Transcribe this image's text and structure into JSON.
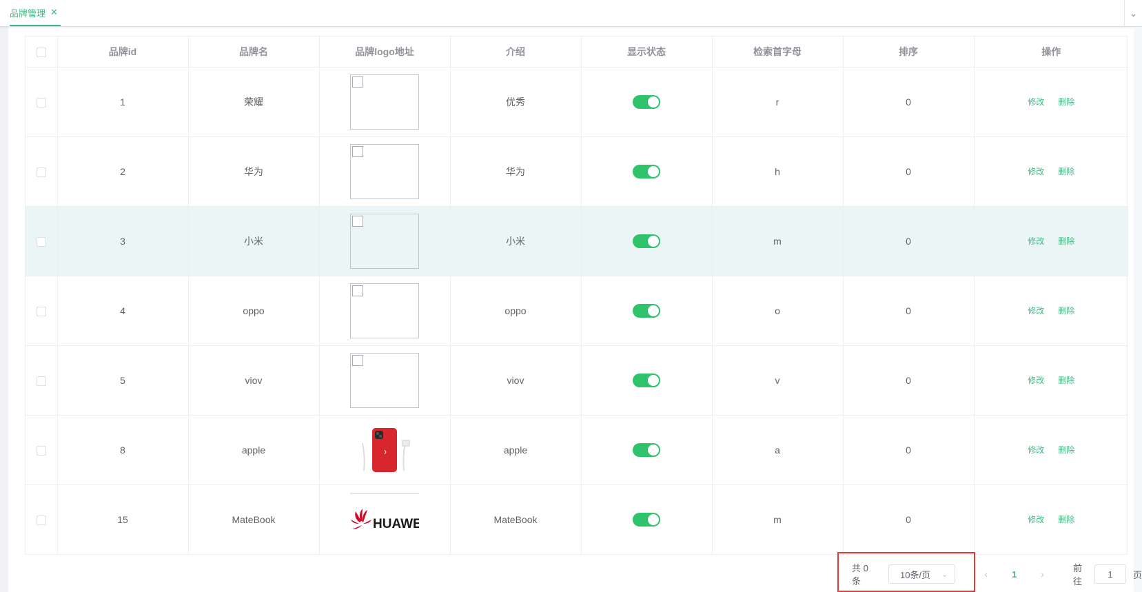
{
  "tabs": [
    {
      "label": "品牌管理",
      "active": true
    }
  ],
  "table": {
    "headers": [
      "品牌id",
      "品牌名",
      "品牌logo地址",
      "介绍",
      "显示状态",
      "检索首字母",
      "排序",
      "操作"
    ],
    "rows": [
      {
        "id": "1",
        "name": "荣耀",
        "logo": "broken",
        "desc": "优秀",
        "show": true,
        "letter": "r",
        "sort": "0"
      },
      {
        "id": "2",
        "name": "华为",
        "logo": "broken",
        "desc": "华为",
        "show": true,
        "letter": "h",
        "sort": "0"
      },
      {
        "id": "3",
        "name": "小米",
        "logo": "broken",
        "desc": "小米",
        "show": true,
        "letter": "m",
        "sort": "0"
      },
      {
        "id": "4",
        "name": "oppo",
        "logo": "broken",
        "desc": "oppo",
        "show": true,
        "letter": "o",
        "sort": "0"
      },
      {
        "id": "5",
        "name": "viov",
        "logo": "broken",
        "desc": "viov",
        "show": true,
        "letter": "v",
        "sort": "0"
      },
      {
        "id": "8",
        "name": "apple",
        "logo": "iphone-image",
        "desc": "apple",
        "show": true,
        "letter": "a",
        "sort": "0"
      },
      {
        "id": "15",
        "name": "MateBook",
        "logo": "huawei-logo",
        "desc": "MateBook",
        "show": true,
        "letter": "m",
        "sort": "0"
      }
    ],
    "edit_label": "修改",
    "delete_label": "删除"
  },
  "pagination": {
    "total": "共 0 条",
    "page_size": "10条/页",
    "current": "1",
    "goto_label": "前往",
    "goto_value": "1",
    "page_suffix": "页"
  },
  "logo_text": {
    "huawei": "HUAWEI"
  },
  "colors": {
    "accent": "#42b983",
    "switch_on": "#2fc36b",
    "highlight": "#e53935",
    "hover_row": "#ecf5f5"
  }
}
